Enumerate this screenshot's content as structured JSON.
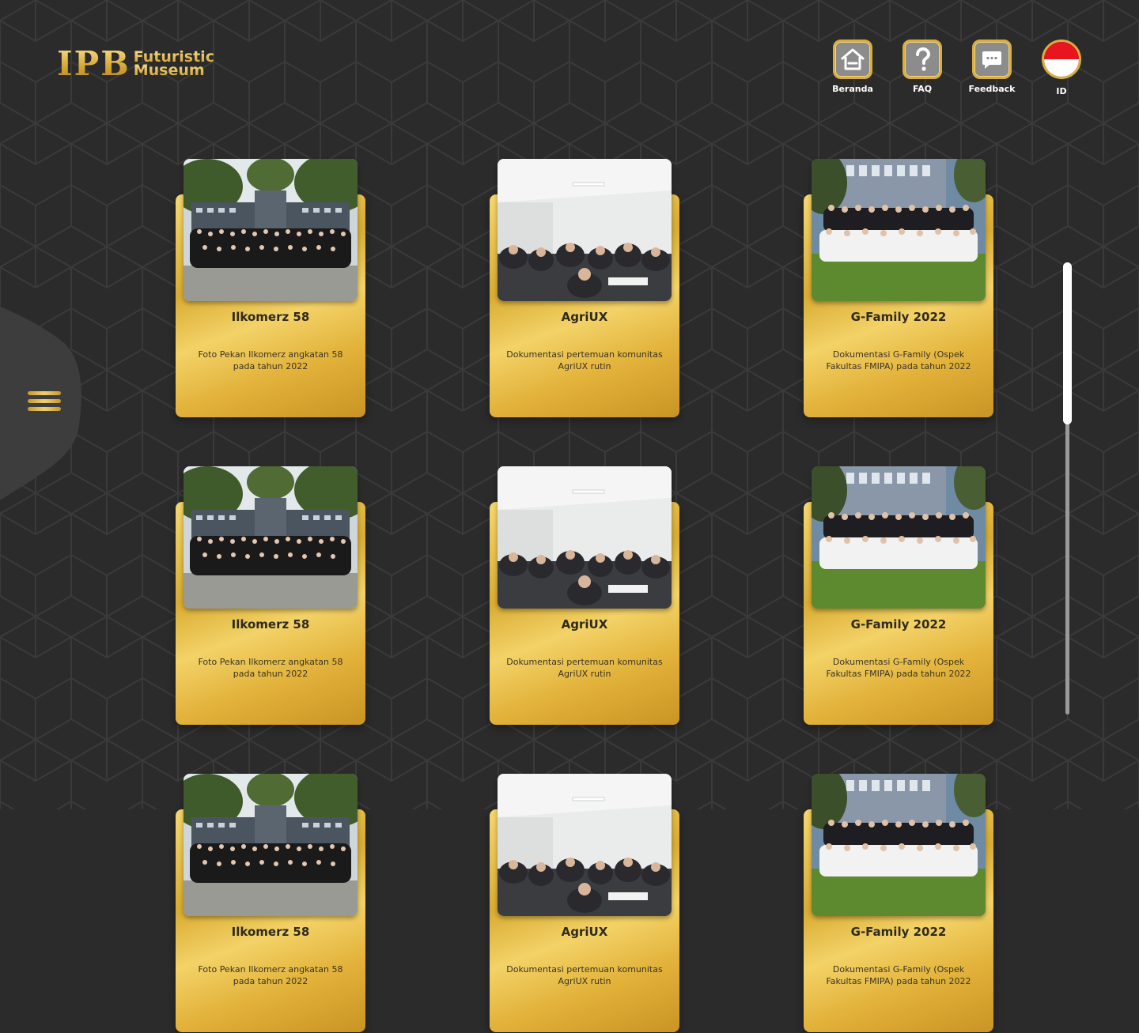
{
  "logo": {
    "main": "IPB",
    "line1": "Futuristic",
    "line2": "Museum"
  },
  "nav": [
    {
      "id": "home",
      "label": "Beranda",
      "icon": "home-icon"
    },
    {
      "id": "faq",
      "label": "FAQ",
      "icon": "question-icon"
    },
    {
      "id": "feedback",
      "label": "Feedback",
      "icon": "chat-bubble-icon"
    }
  ],
  "language": {
    "label": "ID",
    "flag": "indonesia-flag-icon"
  },
  "menu": {
    "icon": "hamburger-menu-icon"
  },
  "colors": {
    "gold": "#d9ac32",
    "gold_light": "#f6d76f",
    "background": "#2b2b2b",
    "nav_button": "#8c8c8c"
  },
  "gallery": {
    "rows": [
      [
        {
          "title": "Ilkomerz 58",
          "desc": "Foto Pekan Ilkomerz angkatan 58 pada tahun 2022",
          "photo": "ilkomerz-group-photo"
        },
        {
          "title": "AgriUX",
          "desc": "Dokumentasi pertemuan komunitas AgriUX rutin",
          "photo": "agriux-meeting-photo"
        },
        {
          "title": "G-Family 2022",
          "desc": "Dokumentasi G-Family (Ospek Fakultas FMIPA) pada tahun 2022",
          "photo": "gfamily-group-photo"
        }
      ],
      [
        {
          "title": "Ilkomerz 58",
          "desc": "Foto Pekan Ilkomerz angkatan 58 pada tahun 2022",
          "photo": "ilkomerz-group-photo"
        },
        {
          "title": "AgriUX",
          "desc": "Dokumentasi pertemuan komunitas AgriUX rutin",
          "photo": "agriux-meeting-photo"
        },
        {
          "title": "G-Family 2022",
          "desc": "Dokumentasi G-Family (Ospek Fakultas FMIPA) pada tahun 2022",
          "photo": "gfamily-group-photo"
        }
      ],
      [
        {
          "title": "Ilkomerz 58",
          "desc": "Foto Pekan Ilkomerz angkatan 58 pada tahun 2022",
          "photo": "ilkomerz-group-photo"
        },
        {
          "title": "AgriUX",
          "desc": "Dokumentasi pertemuan komunitas AgriUX rutin",
          "photo": "agriux-meeting-photo"
        },
        {
          "title": "G-Family 2022",
          "desc": "Dokumentasi G-Family (Ospek Fakultas FMIPA) pada tahun 2022",
          "photo": "gfamily-group-photo"
        }
      ]
    ]
  }
}
